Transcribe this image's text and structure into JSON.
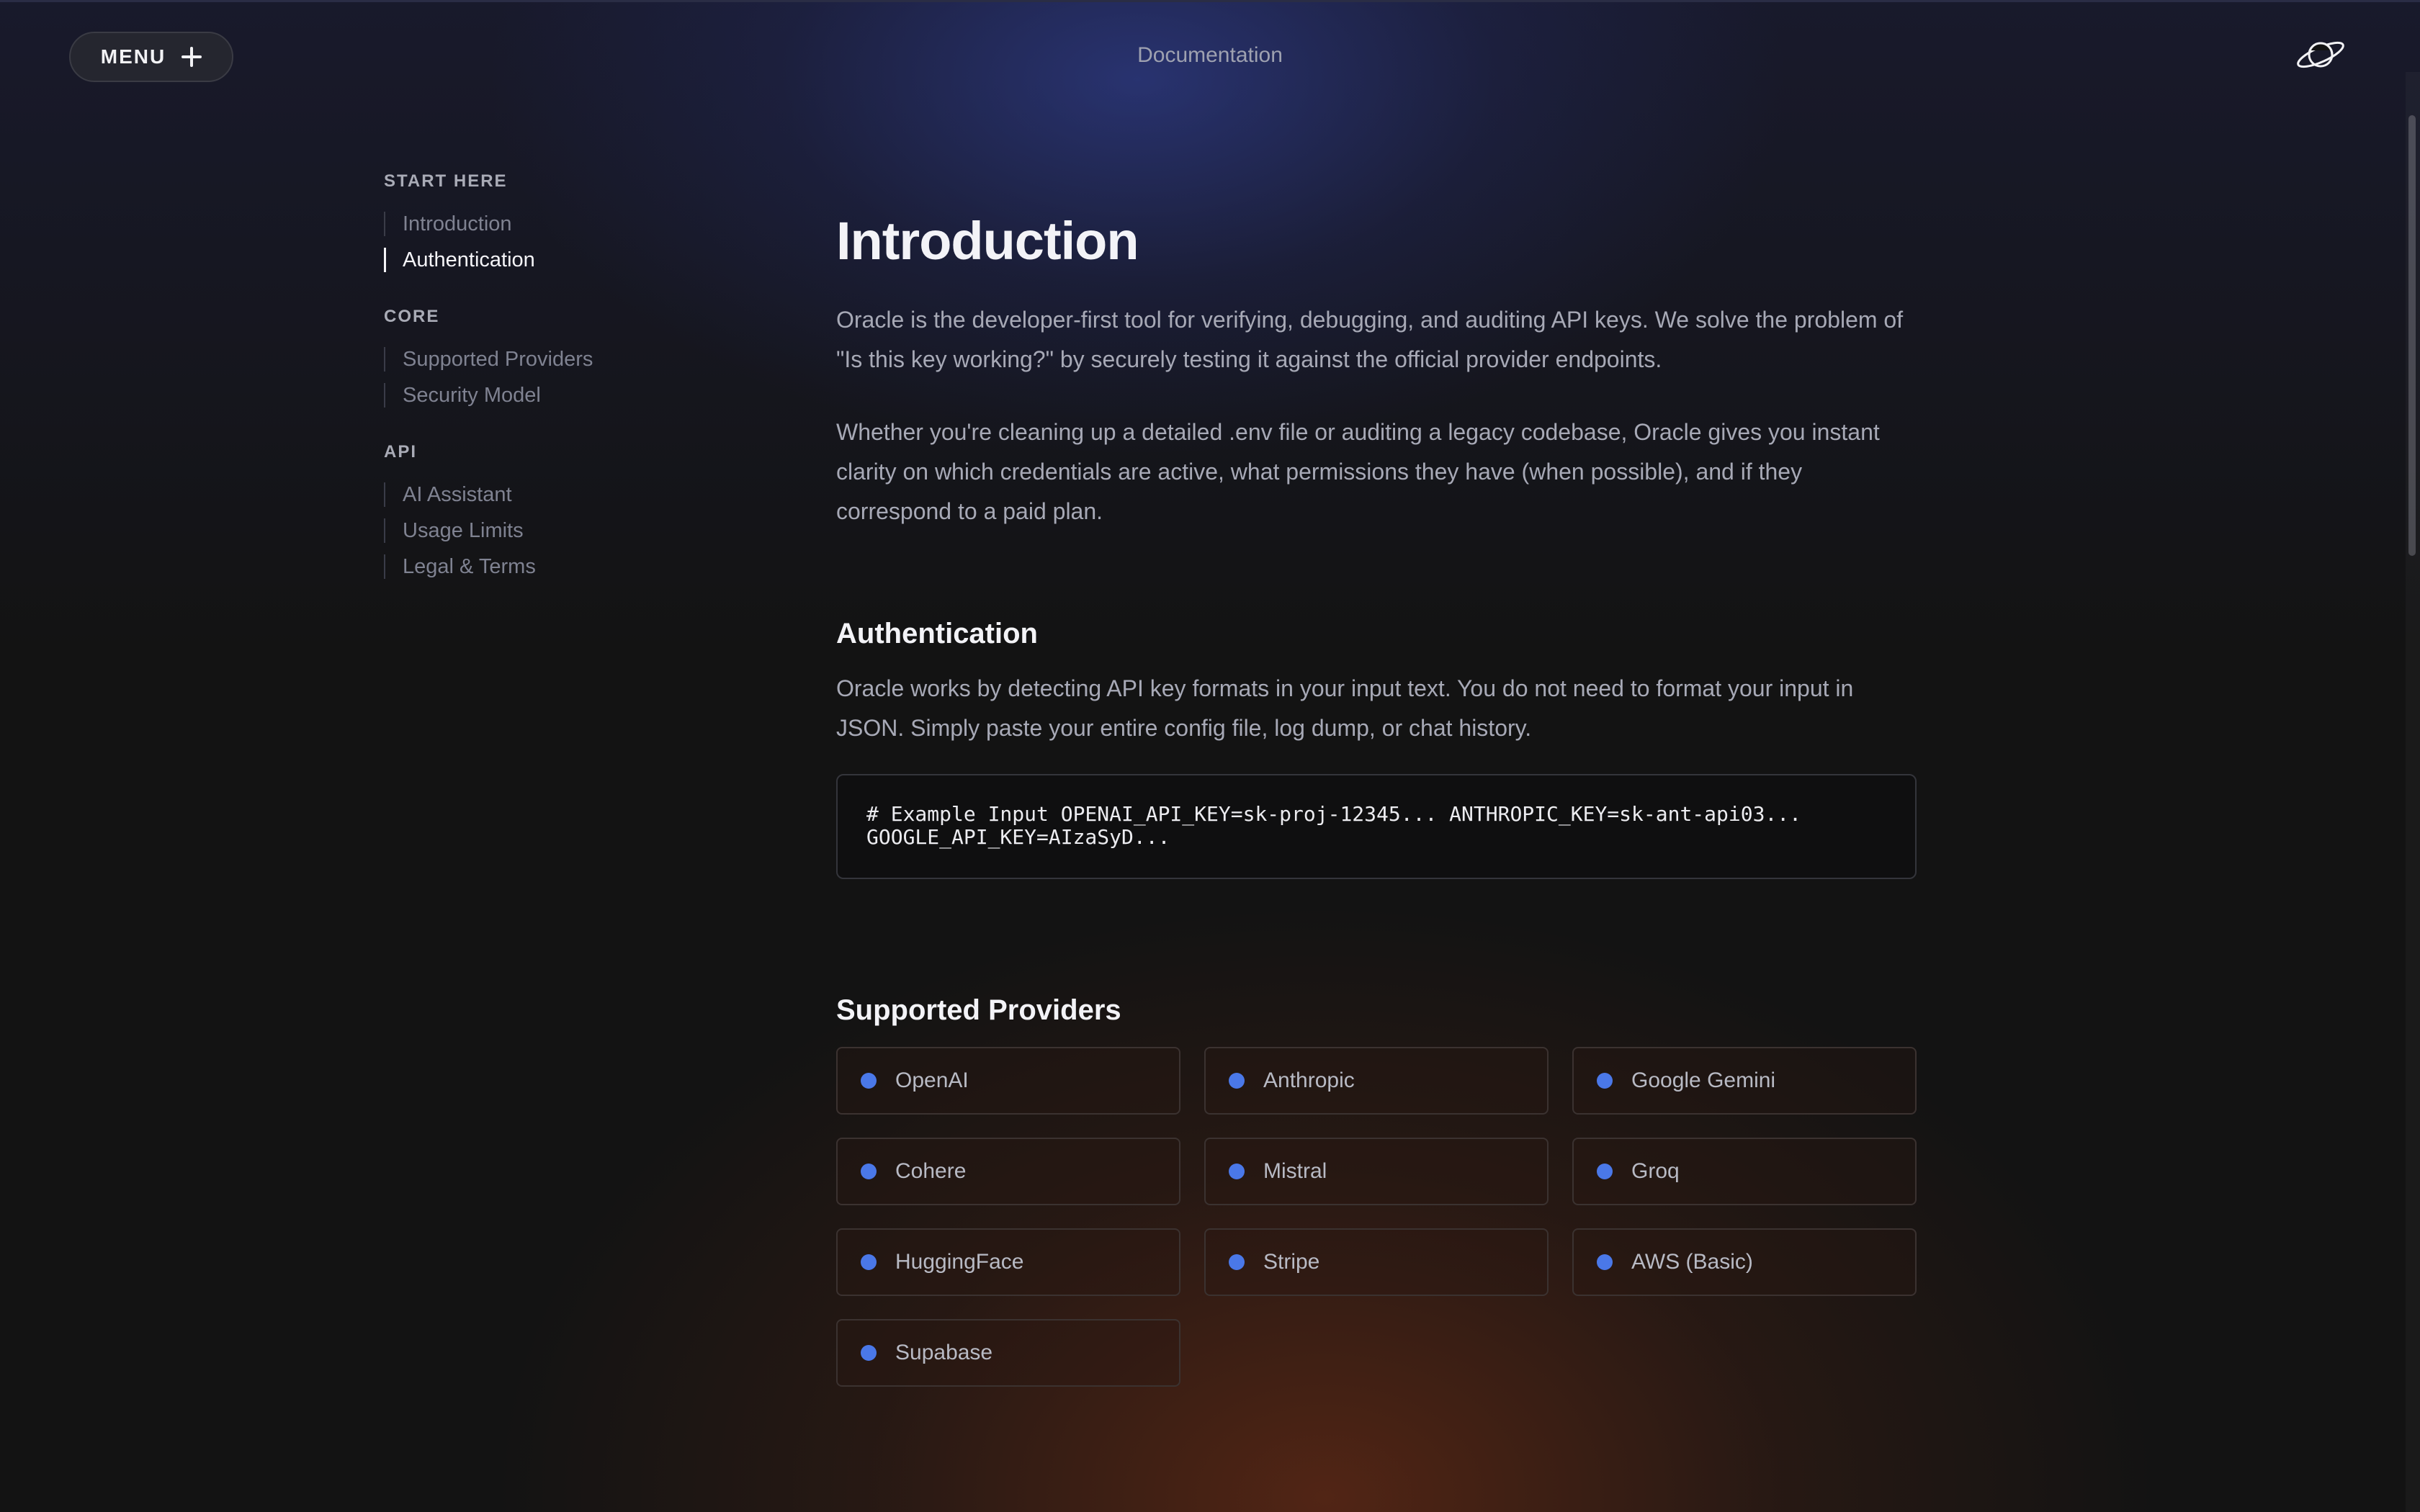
{
  "header": {
    "menu_label": "MENU",
    "title": "Documentation"
  },
  "sidebar": {
    "sections": [
      {
        "title": "START HERE",
        "items": [
          {
            "label": "Introduction"
          },
          {
            "label": "Authentication",
            "active": true
          }
        ]
      },
      {
        "title": "CORE",
        "items": [
          {
            "label": "Supported Providers"
          },
          {
            "label": "Security Model"
          }
        ]
      },
      {
        "title": "API",
        "items": [
          {
            "label": "AI Assistant"
          },
          {
            "label": "Usage Limits"
          },
          {
            "label": "Legal & Terms"
          }
        ]
      }
    ]
  },
  "main": {
    "intro": {
      "heading": "Introduction",
      "p1": "Oracle is the developer-first tool for verifying, debugging, and auditing API keys. We solve the problem of \"Is this key working?\" by securely testing it against the official provider endpoints.",
      "p2": "Whether you're cleaning up a detailed .env file or auditing a legacy codebase, Oracle gives you instant clarity on which credentials are active, what permissions they have (when possible), and if they correspond to a paid plan."
    },
    "auth": {
      "heading": "Authentication",
      "p1": "Oracle works by detecting API key formats in your input text. You do not need to format your input in JSON. Simply paste your entire config file, log dump, or chat history.",
      "code": "# Example Input OPENAI_API_KEY=sk-proj-12345... ANTHROPIC_KEY=sk-ant-api03... GOOGLE_API_KEY=AIzaSyD..."
    },
    "providers": {
      "heading": "Supported Providers",
      "items": [
        "OpenAI",
        "Anthropic",
        "Google Gemini",
        "Cohere",
        "Mistral",
        "Groq",
        "HuggingFace",
        "Stripe",
        "AWS (Basic)",
        "Supabase"
      ]
    }
  },
  "colors": {
    "accent_dot": "#4a78e8",
    "background": "#131313"
  },
  "icons": {
    "logo": "planet-icon",
    "menu": "plus-icon"
  }
}
